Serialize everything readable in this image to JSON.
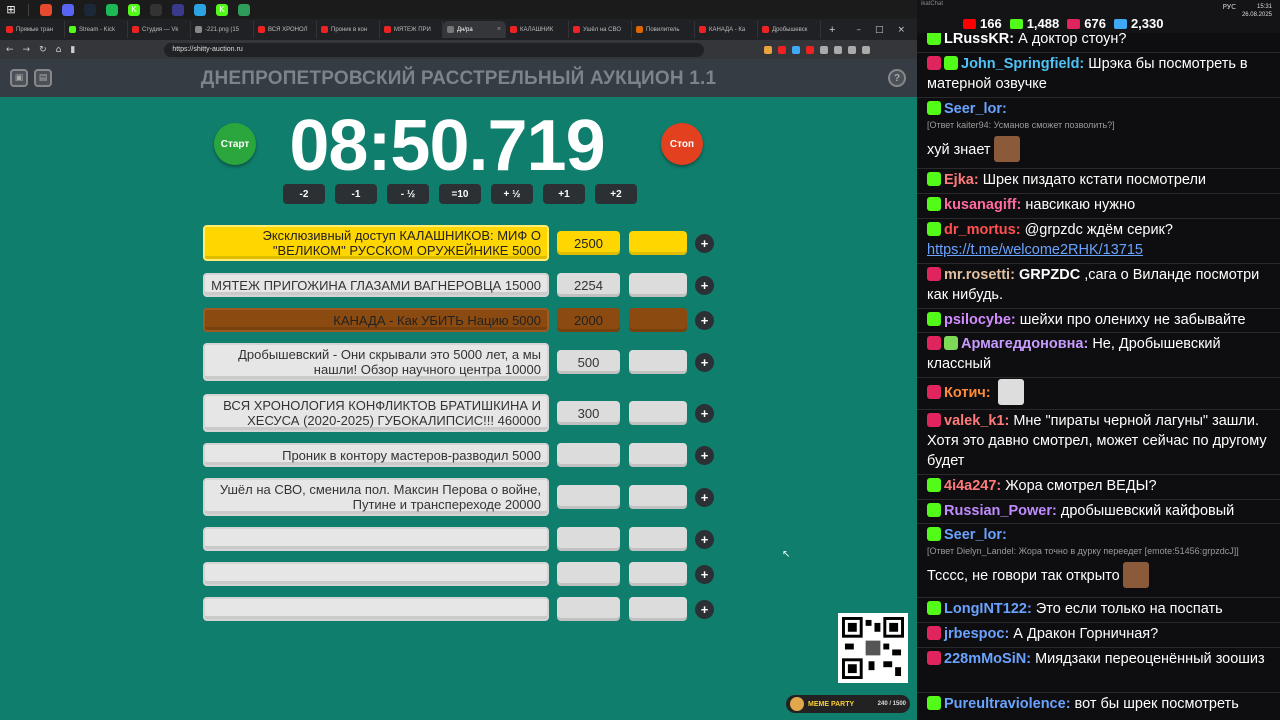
{
  "taskbar": {
    "icons": [
      "windows-icon",
      "brave-icon",
      "discord-icon",
      "steam-icon",
      "spotify-icon",
      "kick-icon",
      "ghub-icon",
      "obs-icon",
      "telegram-icon",
      "kick-studio-icon",
      "green-app-icon"
    ]
  },
  "browser": {
    "tabs": [
      {
        "label": "Прямые тран",
        "color": "#e22"
      },
      {
        "label": "Stream - Kick",
        "color": "#53fc18"
      },
      {
        "label": "Студия — Vk",
        "color": "#e22"
      },
      {
        "label": "-221.png (15",
        "color": "#888"
      },
      {
        "label": "ВСЯ ХРОНОЛ",
        "color": "#e22"
      },
      {
        "label": "Проник в кон",
        "color": "#e22"
      },
      {
        "label": "МЯТЕЖ ПРИ",
        "color": "#e22"
      },
      {
        "label": "Дн/ра",
        "color": "#777",
        "active": true
      },
      {
        "label": "КАЛАШНИК",
        "color": "#e22"
      },
      {
        "label": "Ушёл на СВО",
        "color": "#e22"
      },
      {
        "label": "Повилитель",
        "color": "#d60"
      },
      {
        "label": "КАНАДА - Ка",
        "color": "#e22"
      },
      {
        "label": "Дробышевск",
        "color": "#e22"
      }
    ],
    "new_tab": "+",
    "url": "https://shitty-auction.ru"
  },
  "auction": {
    "title": "ДНЕПРОПЕТРОВСКИЙ РАССТРЕЛЬНЫЙ АУКЦИОН 1.1",
    "start_label": "Старт",
    "stop_label": "Стоп",
    "timer": "08:50.719",
    "adjust": [
      "-2",
      "-1",
      "- ½",
      "=10",
      "+ ½",
      "+1",
      "+2"
    ],
    "lots": [
      {
        "name": "Эксклюзивный доступ КАЛАШНИКОВ: МИФ О \"ВЕЛИКОМ\" РУССКОМ ОРУЖЕЙНИКЕ 5000",
        "sum": "2500",
        "style": "gold"
      },
      {
        "name": "МЯТЕЖ ПРИГОЖИНА ГЛАЗАМИ ВАГНЕРОВЦА 15000",
        "sum": "2254",
        "style": "plain"
      },
      {
        "name": "КАНАДА - Как УБИТЬ Нацию 5000",
        "sum": "2000",
        "style": "brown"
      },
      {
        "name": "Дробышевский - Они скрывали это 5000 лет, а мы нашли! Обзор научного центра 10000",
        "sum": "500",
        "style": "plain"
      },
      {
        "name": "ВСЯ ХРОНОЛОГИЯ КОНФЛИКТОВ БРАТИШКИНА И ХЕСУСА (2020-2025) ГУБОКАЛИПСИС!!! 460000",
        "sum": "300",
        "style": "plain"
      },
      {
        "name": "Проник в контору мастеров-разводил 5000",
        "sum": "",
        "style": "plain"
      },
      {
        "name": "Ушёл на СВО, сменила пол. Максин Перова о войне, Путине и транспереходе 20000",
        "sum": "",
        "style": "plain"
      },
      {
        "name": "",
        "sum": "",
        "style": "plain"
      },
      {
        "name": "",
        "sum": "",
        "style": "plain"
      },
      {
        "name": "",
        "sum": "",
        "style": "plain"
      }
    ],
    "plus_label": "+",
    "meme_party": {
      "label": "MEME PARTY",
      "progress": "240 / 1500"
    }
  },
  "chat": {
    "app_name": "ikatChat",
    "stats": [
      {
        "value": "166",
        "icon": "youtube-icon",
        "color": "#ff0000"
      },
      {
        "value": "1,488",
        "icon": "kick-icon",
        "color": "#53fc18"
      },
      {
        "value": "676",
        "icon": "vk-live-icon",
        "color": "#e0245e"
      },
      {
        "value": "2,330",
        "icon": "viewers-icon",
        "color": "#3fa9f5"
      }
    ],
    "time": "15:31",
    "date": "26.08.2025",
    "lang": "РУС",
    "messages": [
      {
        "badges": [
          "kick"
        ],
        "nick": "LRussKR",
        "color": "#ffffff",
        "text": "А доктор стоун?"
      },
      {
        "badges": [
          "live",
          "pen"
        ],
        "nick": "John_Springfield",
        "color": "#4fc3f7",
        "text": "Шрэка бы посмотреть в матерной озвучке"
      },
      {
        "badges": [
          "kick"
        ],
        "nick": "Seer_lor",
        "color": "#6aa3ff",
        "reply": "[Ответ kaiter94: Усманов сможет позволить?]",
        "text": "хуй знает",
        "emote": true
      },
      {
        "badges": [
          "kick"
        ],
        "nick": "Ejka",
        "color": "#ff7b7b",
        "text": "Шрек пиздато кстати посмотрели"
      },
      {
        "badges": [
          "kick"
        ],
        "nick": "kusanagiff",
        "color": "#ff6aa0",
        "text": "навсикаю нужно"
      },
      {
        "badges": [
          "kick"
        ],
        "nick": "dr_mortus",
        "color": "#ff5050",
        "text": "@grpzdc ждём серик?",
        "link": "https://t.me/welcome2RHK/13715"
      },
      {
        "badges": [
          "live"
        ],
        "nick": "mr.rosetti",
        "color": "#e0c0a0",
        "text_bold": "GRPZDC",
        "text": ",сага о Виланде посмотри как нибудь."
      },
      {
        "badges": [
          "kick"
        ],
        "nick": "psilocybe",
        "color": "#d28cff",
        "text": "шейхи про олениху не забывайте"
      },
      {
        "badges": [
          "live",
          "shield"
        ],
        "nick": "Армагеддоновна",
        "color": "#c89cff",
        "text": "Не, Дробышевский классный"
      },
      {
        "badges": [
          "live"
        ],
        "nick": "Котич",
        "color": "#ff8a3a",
        "text": "",
        "emote": true
      },
      {
        "badges": [
          "live"
        ],
        "nick": "valek_k1",
        "color": "#ff7b7b",
        "text": "Мне \"пираты черной лагуны\" зашли. Хотя это давно смотрел, может сейчас по другому будет"
      },
      {
        "badges": [
          "kick"
        ],
        "nick": "4i4a247",
        "color": "#ff7b7b",
        "text": "Жора смотрел ВЕДЫ?"
      },
      {
        "badges": [
          "kick"
        ],
        "nick": "Russian_Power",
        "color": "#c08cff",
        "text": "дробышевский кайфовый"
      },
      {
        "badges": [
          "kick"
        ],
        "nick": "Seer_lor",
        "color": "#6aa3ff",
        "reply": "[Ответ Dielyn_Landel: Жора точно в дурку переедет [emote:51456:grpzdcJ]]",
        "text": "Тсссс, не говори так открыто",
        "emote": true
      },
      {
        "badges": [
          "kick"
        ],
        "nick": "LongINT122",
        "color": "#6aa3ff",
        "text": "Это если только на поспать"
      },
      {
        "badges": [
          "live"
        ],
        "nick": "jrbespoc",
        "color": "#6aa3ff",
        "text": "А Дракон Горничная?"
      },
      {
        "badges": [
          "live"
        ],
        "nick": "228mMoSiN",
        "color": "#6aa3ff",
        "text": "Миядзаки переоценённый зоошиз"
      },
      {
        "badges": [
          "kick"
        ],
        "nick": "Pureultraviolence",
        "color": "#6aa3ff",
        "text": "вот бы шрек посмотреть"
      }
    ]
  },
  "colors": {
    "page_bg": "#107e6c",
    "start": "#2aa63c",
    "stop": "#e2401e",
    "gold": "#ffd600",
    "brown": "#8a4a10"
  }
}
